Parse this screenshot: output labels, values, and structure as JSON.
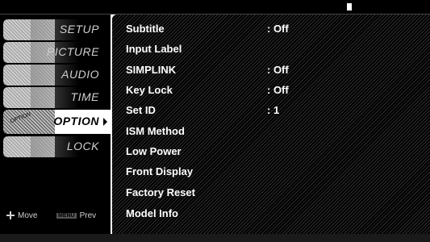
{
  "sidebar": {
    "items": [
      {
        "label": "SETUP"
      },
      {
        "label": "PICTURE"
      },
      {
        "label": "AUDIO"
      },
      {
        "label": "TIME"
      },
      {
        "label": "OPTION",
        "selected": true,
        "badge": "OPTION"
      },
      {
        "label": "LOCK"
      }
    ],
    "hints": {
      "move": "Move",
      "menu_key": "MENU",
      "prev": "Prev"
    }
  },
  "option_menu": {
    "rows": [
      {
        "name": "Subtitle",
        "value": ": Off"
      },
      {
        "name": "Input Label",
        "value": ""
      },
      {
        "name": "SIMPLINK",
        "value": ": Off"
      },
      {
        "name": "Key Lock",
        "value": ": Off"
      },
      {
        "name": "Set ID",
        "value": ": 1"
      },
      {
        "name": "ISM Method",
        "value": ""
      },
      {
        "name": "Low Power",
        "value": ""
      },
      {
        "name": "Front Display",
        "value": ""
      },
      {
        "name": "Factory Reset",
        "value": ""
      },
      {
        "name": "Model Info",
        "value": ""
      }
    ]
  },
  "colors": {
    "background": "#000000",
    "selected_tab": "#ffffff",
    "text": "#ffffff",
    "inactive_label": "#cfcfcf"
  }
}
